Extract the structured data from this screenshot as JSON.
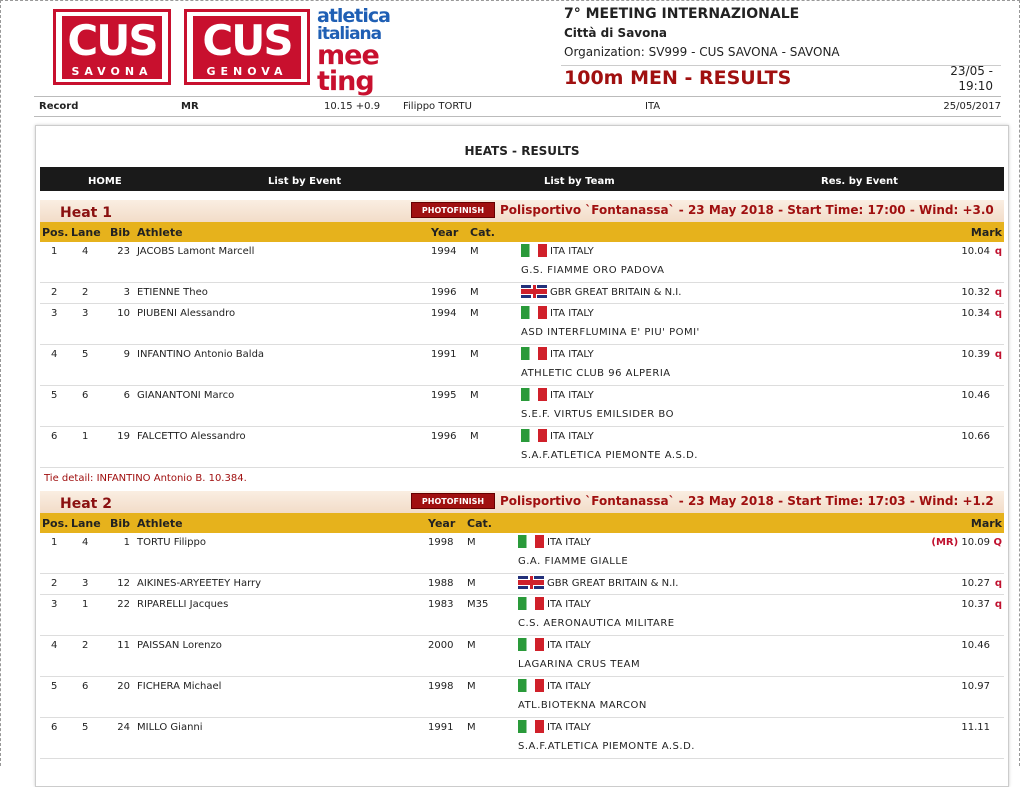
{
  "logos": {
    "savona": {
      "big": "CUS",
      "small": "SAVONA"
    },
    "genova": {
      "big": "CUS",
      "small": "GENOVA"
    },
    "aim": {
      "l1": "atletica",
      "l2": "italiana",
      "l3a": "mee",
      "l3b": "ting"
    }
  },
  "meeting": {
    "title": "7° MEETING INTERNAZIONALE",
    "city": "Città di Savona",
    "organization": "Organization: SV999 - CUS SAVONA - SAVONA",
    "event": "100m MEN - RESULTS",
    "date": "23/05 -",
    "time": "19:10"
  },
  "record": {
    "label": "Record",
    "type": "MR",
    "mark": "10.15 +0.9",
    "athlete": "Filippo TORTU",
    "nation": "ITA",
    "date": "25/05/2017"
  },
  "section_title": "HEATS - RESULTS",
  "nav": {
    "home": "HOME",
    "by_event": "List by Event",
    "by_team": "List by Team",
    "res_event": "Res. by Event"
  },
  "photofinish": "PHOTOFINISH",
  "columns": {
    "pos": "Pos.",
    "lane": "Lane",
    "bib": "Bib",
    "athlete": "Athlete",
    "year": "Year",
    "cat": "Cat.",
    "mark": "Mark"
  },
  "heats": [
    {
      "name": "Heat 1",
      "info": "Polisportivo `Fontanassa` - 23 May 2018 - Start Time: 17:00 - Wind: +3.0",
      "rows": [
        {
          "pos": "1",
          "lane": "4",
          "bib": "23",
          "athlete": "JACOBS Lamont Marcell",
          "year": "1994",
          "cat": "M",
          "nation": "ITA ITALY",
          "club": "G.S. FIAMME ORO PADOVA",
          "mark": "10.04",
          "flag": "q",
          "mr": ""
        },
        {
          "pos": "2",
          "lane": "2",
          "bib": "3",
          "athlete": "ETIENNE Theo",
          "year": "1996",
          "cat": "M",
          "nation": "GBR GREAT BRITAIN & N.I.",
          "club": "",
          "mark": "10.32",
          "flag": "q",
          "mr": ""
        },
        {
          "pos": "3",
          "lane": "3",
          "bib": "10",
          "athlete": "PIUBENI Alessandro",
          "year": "1994",
          "cat": "M",
          "nation": "ITA ITALY",
          "club": "ASD INTERFLUMINA E' PIU' POMI'",
          "mark": "10.34",
          "flag": "q",
          "mr": ""
        },
        {
          "pos": "4",
          "lane": "5",
          "bib": "9",
          "athlete": "INFANTINO Antonio Balda",
          "year": "1991",
          "cat": "M",
          "nation": "ITA ITALY",
          "club": "ATHLETIC CLUB 96 ALPERIA",
          "mark": "10.39",
          "flag": "q",
          "mr": ""
        },
        {
          "pos": "5",
          "lane": "6",
          "bib": "6",
          "athlete": "GIANANTONI Marco",
          "year": "1995",
          "cat": "M",
          "nation": "ITA ITALY",
          "club": "S.E.F. VIRTUS EMILSIDER BO",
          "mark": "10.46",
          "flag": "",
          "mr": ""
        },
        {
          "pos": "6",
          "lane": "1",
          "bib": "19",
          "athlete": "FALCETTO Alessandro",
          "year": "1996",
          "cat": "M",
          "nation": "ITA ITALY",
          "club": "S.A.F.ATLETICA PIEMONTE A.S.D.",
          "mark": "10.66",
          "flag": "",
          "mr": ""
        }
      ],
      "tie": "Tie detail: INFANTINO Antonio B. 10.384."
    },
    {
      "name": "Heat 2",
      "info": "Polisportivo `Fontanassa` - 23 May 2018 - Start Time: 17:03 - Wind: +1.2",
      "rows": [
        {
          "pos": "1",
          "lane": "4",
          "bib": "1",
          "athlete": "TORTU Filippo",
          "year": "1998",
          "cat": "M",
          "nation": "ITA ITALY",
          "club": "G.A. FIAMME GIALLE",
          "mark": "10.09",
          "flag": "Q",
          "mr": "(MR)"
        },
        {
          "pos": "2",
          "lane": "3",
          "bib": "12",
          "athlete": "AIKINES-ARYEETEY Harry",
          "year": "1988",
          "cat": "M",
          "nation": "GBR GREAT BRITAIN & N.I.",
          "club": "",
          "mark": "10.27",
          "flag": "q",
          "mr": ""
        },
        {
          "pos": "3",
          "lane": "1",
          "bib": "22",
          "athlete": "RIPARELLI Jacques",
          "year": "1983",
          "cat": "M35",
          "nation": "ITA ITALY",
          "club": "C.S. AERONAUTICA MILITARE",
          "mark": "10.37",
          "flag": "q",
          "mr": ""
        },
        {
          "pos": "4",
          "lane": "2",
          "bib": "11",
          "athlete": "PAISSAN Lorenzo",
          "year": "2000",
          "cat": "M",
          "nation": "ITA ITALY",
          "club": "LAGARINA CRUS TEAM",
          "mark": "10.46",
          "flag": "",
          "mr": ""
        },
        {
          "pos": "5",
          "lane": "6",
          "bib": "20",
          "athlete": "FICHERA Michael",
          "year": "1998",
          "cat": "M",
          "nation": "ITA ITALY",
          "club": "ATL.BIOTEKNA MARCON",
          "mark": "10.97",
          "flag": "",
          "mr": ""
        },
        {
          "pos": "6",
          "lane": "5",
          "bib": "24",
          "athlete": "MILLO Gianni",
          "year": "1991",
          "cat": "M",
          "nation": "ITA ITALY",
          "club": "S.A.F.ATLETICA PIEMONTE A.S.D.",
          "mark": "11.11",
          "flag": "",
          "mr": ""
        }
      ],
      "tie": ""
    }
  ]
}
